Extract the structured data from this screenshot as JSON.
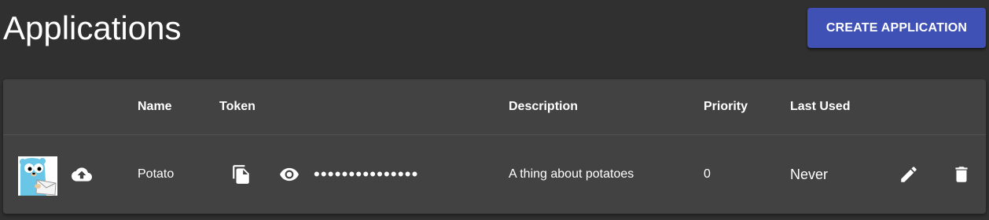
{
  "page": {
    "title": "Applications",
    "create_button_label": "CREATE APPLICATION"
  },
  "colors": {
    "background": "#303030",
    "card": "#424242",
    "primary_button": "#3f51b5",
    "text": "#ffffff"
  },
  "table": {
    "columns": [
      "",
      "",
      "Name",
      "Token",
      "Description",
      "Priority",
      "Last Used",
      "",
      ""
    ],
    "rows": [
      {
        "image_icon": "gopher-mascot-icon",
        "upload_icon": "cloud-upload-icon",
        "name": "Potato",
        "copy_icon": "copy-icon",
        "visibility_icon": "eye-icon",
        "token_masked": "•••••••••••••••",
        "description": "A thing about potatoes",
        "priority": "0",
        "last_used": "Never",
        "edit_icon": "pencil-icon",
        "delete_icon": "trash-icon"
      }
    ]
  }
}
